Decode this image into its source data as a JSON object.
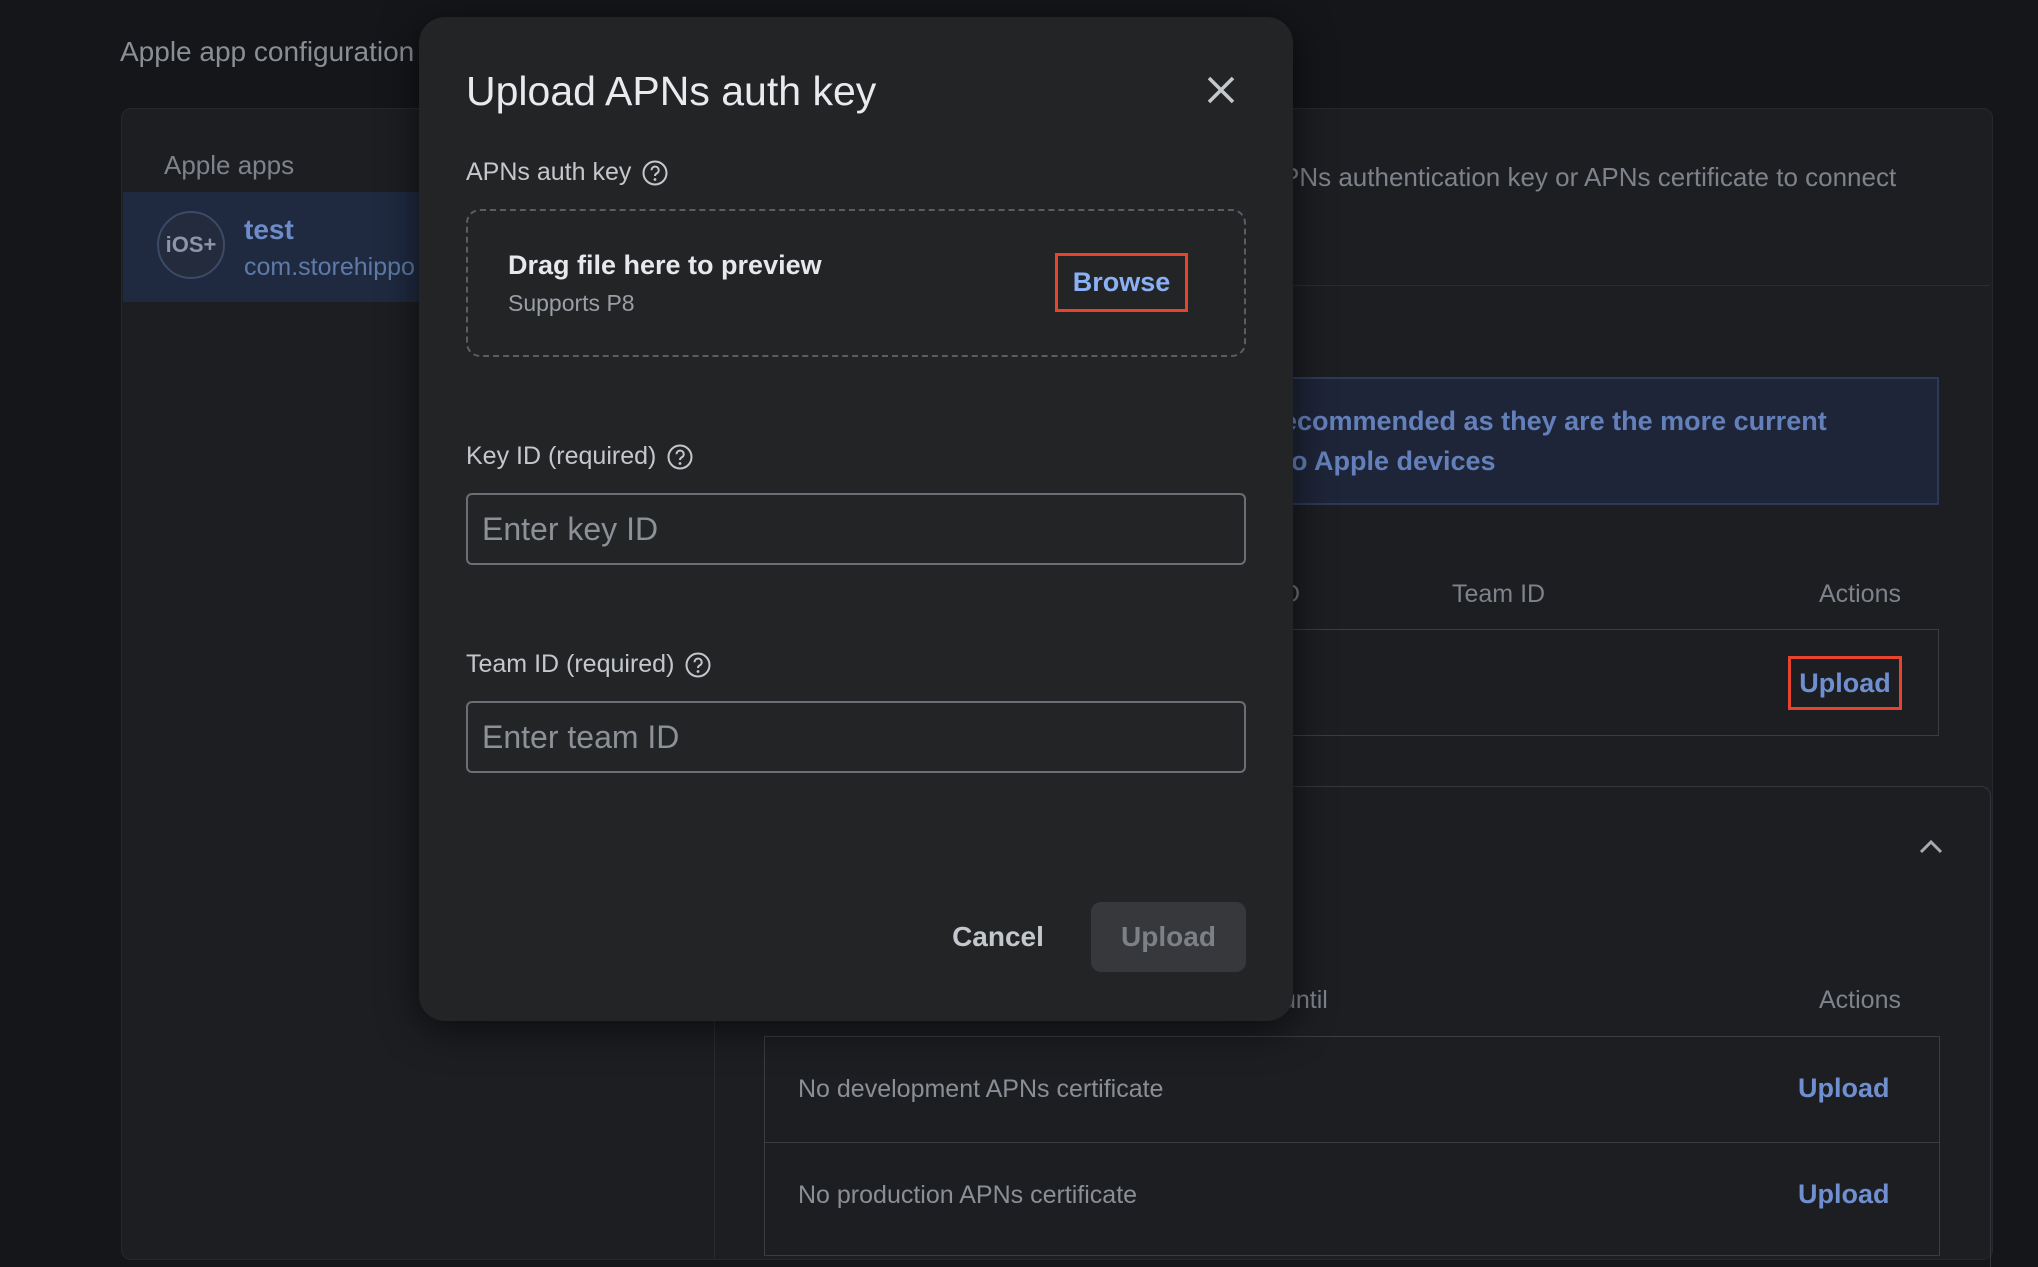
{
  "page": {
    "title": "Apple app configuration",
    "apps_heading": "Apple apps",
    "app": {
      "icon_text": "iOS+",
      "name": "test",
      "bundle_id": "com.storehippo."
    },
    "description_fragment": "PNs authentication key or APNs certificate to connect",
    "info_line1": "ecommended as they are the more current",
    "info_line2": "to Apple devices",
    "auth_key_table": {
      "headers": [
        "D",
        "Team ID",
        "Actions"
      ],
      "row_action": "Upload"
    },
    "cert_table": {
      "headers": [
        "until",
        "Actions"
      ],
      "rows": [
        {
          "label": "No development APNs certificate",
          "action": "Upload"
        },
        {
          "label": "No production APNs certificate",
          "action": "Upload"
        }
      ]
    }
  },
  "modal": {
    "title": "Upload APNs auth key",
    "auth_key_label": "APNs auth key",
    "drop_title": "Drag file here to preview",
    "drop_sub": "Supports P8",
    "browse": "Browse",
    "key_id_label": "Key ID (required)",
    "key_id_placeholder": "Enter key ID",
    "key_id_value": "",
    "team_id_label": "Team ID (required)",
    "team_id_placeholder": "Enter team ID",
    "team_id_value": "",
    "cancel": "Cancel",
    "upload": "Upload"
  },
  "colors": {
    "accent_link": "#6f8fd0",
    "highlight_box": "#e8432d",
    "modal_bg": "#232426",
    "page_bg": "#15161a"
  }
}
